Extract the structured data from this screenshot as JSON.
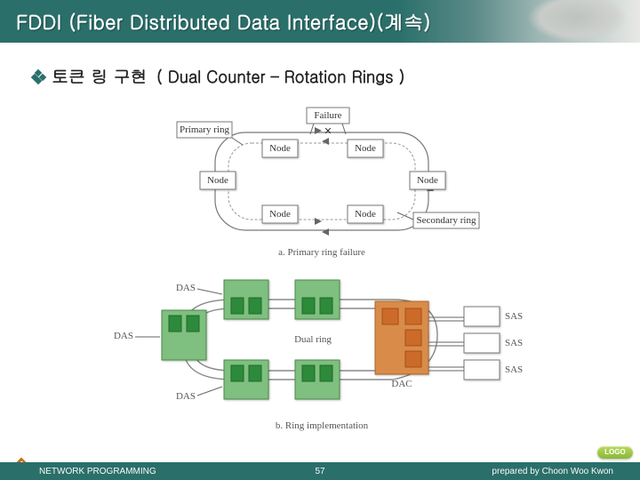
{
  "title": "FDDI (Fiber Distributed Data Interface)(계속)",
  "subhead": {
    "main": "토큰 링 구현",
    "paren": "( Dual Counter – Rotation Rings )"
  },
  "diag_a": {
    "primary": "Primary ring",
    "failure": "Failure",
    "node": "Node",
    "secondary": "Secondary ring",
    "caption": "a. Primary ring failure"
  },
  "diag_b": {
    "das": "DAS",
    "dac": "DAC",
    "sas": "SAS",
    "dual": "Dual ring",
    "caption": "b. Ring implementation"
  },
  "footer": {
    "left": "NETWORK PROGRAMMING",
    "page": "57",
    "right": "prepared by Choon Woo Kwon",
    "logo": "LOGO"
  }
}
